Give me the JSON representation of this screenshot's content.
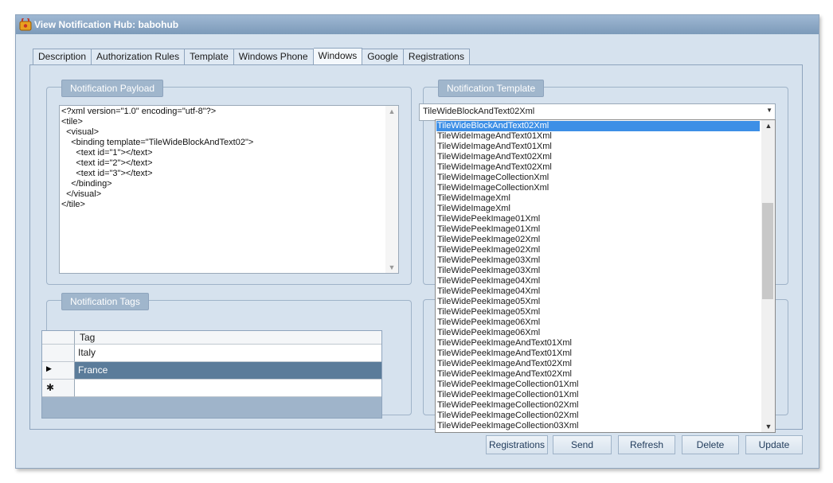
{
  "window": {
    "title": "View Notification Hub: babohub"
  },
  "tabs": [
    {
      "label": "Description",
      "active": false
    },
    {
      "label": "Authorization Rules",
      "active": false
    },
    {
      "label": "Template",
      "active": false
    },
    {
      "label": "Windows Phone",
      "active": false
    },
    {
      "label": "Windows",
      "active": true
    },
    {
      "label": "Google",
      "active": false
    },
    {
      "label": "Registrations",
      "active": false
    }
  ],
  "payload": {
    "group_title": "Notification Payload",
    "lines": [
      "<?xml version=\"1.0\" encoding=\"utf-8\"?>",
      "<tile>",
      "  <visual>",
      "    <binding template=\"TileWideBlockAndText02\">",
      "      <text id=\"1\"></text>",
      "      <text id=\"2\"></text>",
      "      <text id=\"3\"></text>",
      "    </binding>",
      "  </visual>",
      "</tile>"
    ]
  },
  "template": {
    "group_title": "Notification Template",
    "selected": "TileWideBlockAndText02Xml",
    "options": [
      "TileWideBlockAndText02Xml",
      "TileWideImageAndText01Xml",
      "TileWideImageAndText01Xml",
      "TileWideImageAndText02Xml",
      "TileWideImageAndText02Xml",
      "TileWideImageCollectionXml",
      "TileWideImageCollectionXml",
      "TileWideImageXml",
      "TileWideImageXml",
      "TileWidePeekImage01Xml",
      "TileWidePeekImage01Xml",
      "TileWidePeekImage02Xml",
      "TileWidePeekImage02Xml",
      "TileWidePeekImage03Xml",
      "TileWidePeekImage03Xml",
      "TileWidePeekImage04Xml",
      "TileWidePeekImage04Xml",
      "TileWidePeekImage05Xml",
      "TileWidePeekImage05Xml",
      "TileWidePeekImage06Xml",
      "TileWidePeekImage06Xml",
      "TileWidePeekImageAndText01Xml",
      "TileWidePeekImageAndText01Xml",
      "TileWidePeekImageAndText02Xml",
      "TileWidePeekImageAndText02Xml",
      "TileWidePeekImageCollection01Xml",
      "TileWidePeekImageCollection01Xml",
      "TileWidePeekImageCollection02Xml",
      "TileWidePeekImageCollection02Xml",
      "TileWidePeekImageCollection03Xml"
    ]
  },
  "tags": {
    "group_title": "Notification Tags",
    "column_header": "Tag",
    "rows": [
      "Italy",
      "France"
    ],
    "new_row_marker": "✱",
    "current_row_marker": "▶"
  },
  "buttons": {
    "registrations": "Registrations",
    "send": "Send",
    "refresh": "Refresh",
    "delete": "Delete",
    "update": "Update"
  },
  "colors": {
    "title_bar": "#7c9ab9",
    "panel_bg": "#d6e2ee",
    "selected_row": "#5b7c9a",
    "list_selection": "#3d8fe6"
  }
}
